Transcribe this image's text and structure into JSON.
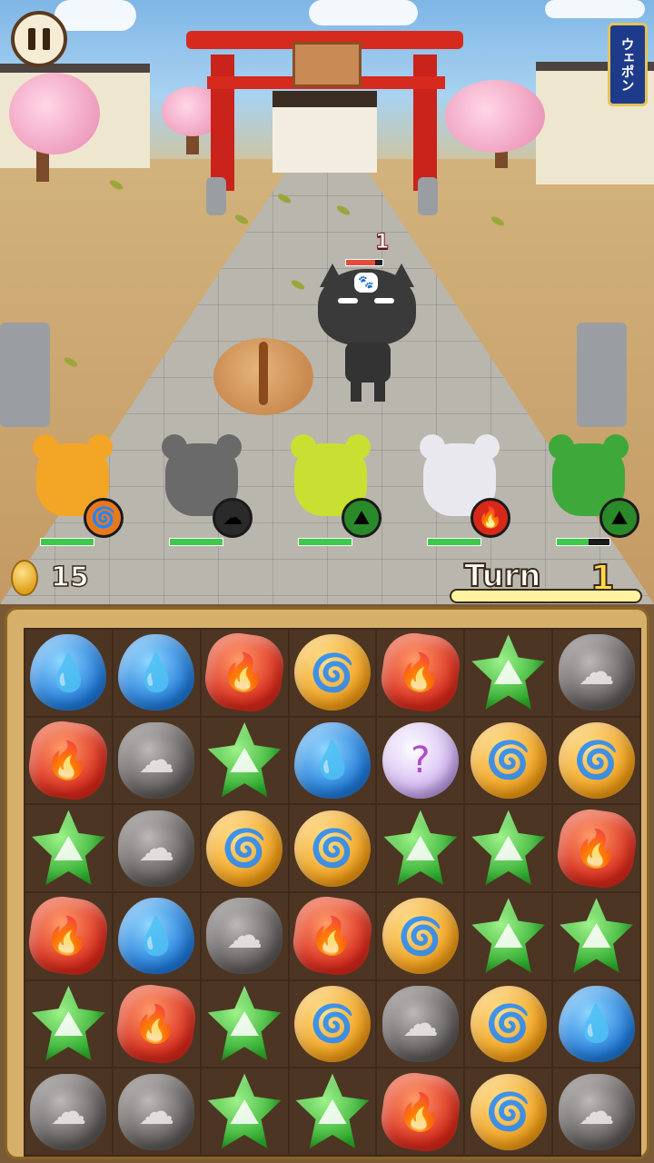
{
  "hud": {
    "weapon_label": "ウェポン",
    "coin_count": "15",
    "turn_label": "Turn",
    "turn_number": "1"
  },
  "enemy": {
    "count": "1",
    "hp_fraction": 0.8
  },
  "allies": [
    {
      "name": "bear",
      "element": "wind",
      "element_icon": "🌀",
      "color": "#f3a526",
      "hp_fraction": 1.0
    },
    {
      "name": "koala",
      "element": "cloud",
      "element_icon": "☁",
      "color": "#6a6a6a",
      "hp_fraction": 1.0
    },
    {
      "name": "frog-warrior",
      "element": "earth",
      "element_icon": "⛰",
      "color": "#c8e032",
      "hp_fraction": 1.0
    },
    {
      "name": "ninja-mouse",
      "element": "fire",
      "element_icon": "🔥",
      "color": "#e8e8ee",
      "hp_fraction": 1.0
    },
    {
      "name": "kappa",
      "element": "earth",
      "element_icon": "⛰",
      "color": "#3fa83a",
      "hp_fraction": 0.6
    }
  ],
  "gem_symbols": {
    "water": "💧",
    "fire": "🔥",
    "wind": "🌀",
    "earth": "⛰",
    "cloud": "☁",
    "mystery": "?"
  },
  "board": [
    [
      "water",
      "water",
      "fire",
      "wind",
      "fire",
      "earth",
      "cloud"
    ],
    [
      "fire",
      "cloud",
      "earth",
      "water",
      "mystery",
      "wind",
      "wind"
    ],
    [
      "earth",
      "cloud",
      "wind",
      "wind",
      "earth",
      "earth",
      "fire"
    ],
    [
      "fire",
      "water",
      "cloud",
      "fire",
      "wind",
      "earth",
      "earth"
    ],
    [
      "earth",
      "fire",
      "earth",
      "wind",
      "cloud",
      "wind",
      "water"
    ],
    [
      "cloud",
      "cloud",
      "earth",
      "earth",
      "fire",
      "wind",
      "cloud"
    ]
  ]
}
